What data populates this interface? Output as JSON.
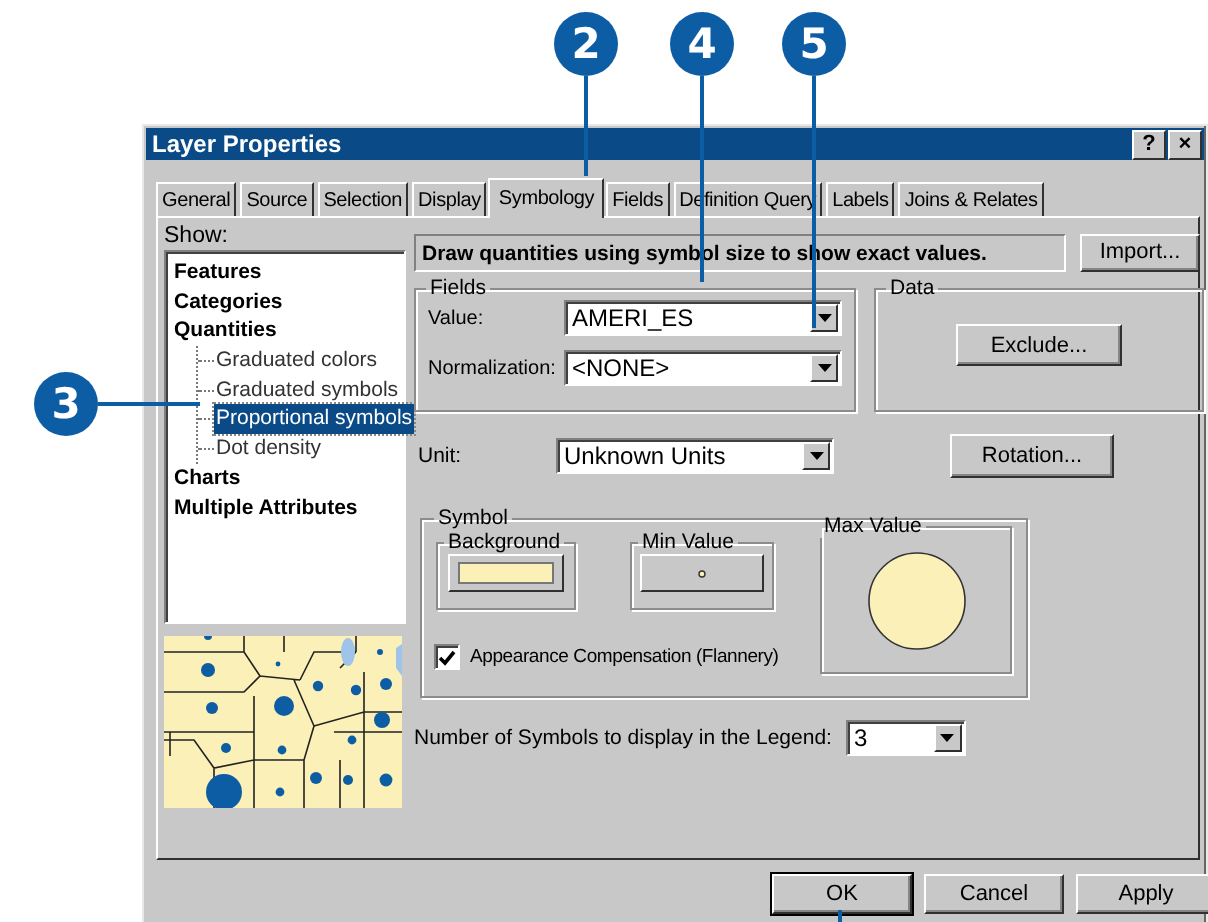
{
  "callouts": [
    {
      "label": "2"
    },
    {
      "label": "4"
    },
    {
      "label": "5"
    },
    {
      "label": "3"
    }
  ],
  "window": {
    "title": "Layer Properties",
    "help_button": "?",
    "close_button": "×"
  },
  "tabs": [
    {
      "label": "General",
      "selected": false
    },
    {
      "label": "Source",
      "selected": false
    },
    {
      "label": "Selection",
      "selected": false
    },
    {
      "label": "Display",
      "selected": false
    },
    {
      "label": "Symbology",
      "selected": true
    },
    {
      "label": "Fields",
      "selected": false
    },
    {
      "label": "Definition Query",
      "selected": false
    },
    {
      "label": "Labels",
      "selected": false
    },
    {
      "label": "Joins & Relates",
      "selected": false
    }
  ],
  "show": {
    "label": "Show:",
    "items": [
      {
        "label": "Features",
        "selected": false
      },
      {
        "label": "Categories",
        "selected": false
      },
      {
        "label": "Quantities",
        "selected": false,
        "children": [
          {
            "label": "Graduated colors",
            "selected": false
          },
          {
            "label": "Graduated symbols",
            "selected": false
          },
          {
            "label": "Proportional symbols",
            "selected": true
          },
          {
            "label": "Dot density",
            "selected": false
          }
        ]
      },
      {
        "label": "Charts",
        "selected": false
      },
      {
        "label": "Multiple Attributes",
        "selected": false
      }
    ]
  },
  "description": "Draw quantities using symbol size to show exact values.",
  "import_button": "Import...",
  "fields": {
    "title": "Fields",
    "value": {
      "label": "Value:",
      "value": "AMERI_ES"
    },
    "normalization": {
      "label": "Normalization:",
      "value": "<NONE>"
    }
  },
  "data": {
    "title": "Data",
    "button": "Exclude..."
  },
  "unit": {
    "label": "Unit:",
    "value": "Unknown Units"
  },
  "rotation_button": "Rotation...",
  "symbol": {
    "title": "Symbol",
    "background": "Background",
    "min_value": "Min Value",
    "max_value": "Max Value",
    "appearance_compensation": {
      "label": "Appearance Compensation (Flannery)",
      "checked": true
    }
  },
  "legend_count": {
    "label": "Number of Symbols to display in the Legend:",
    "value": "3"
  },
  "buttons": [
    {
      "label": "OK",
      "default": true
    },
    {
      "label": "Cancel",
      "default": false
    },
    {
      "label": "Apply",
      "default": false
    }
  ]
}
